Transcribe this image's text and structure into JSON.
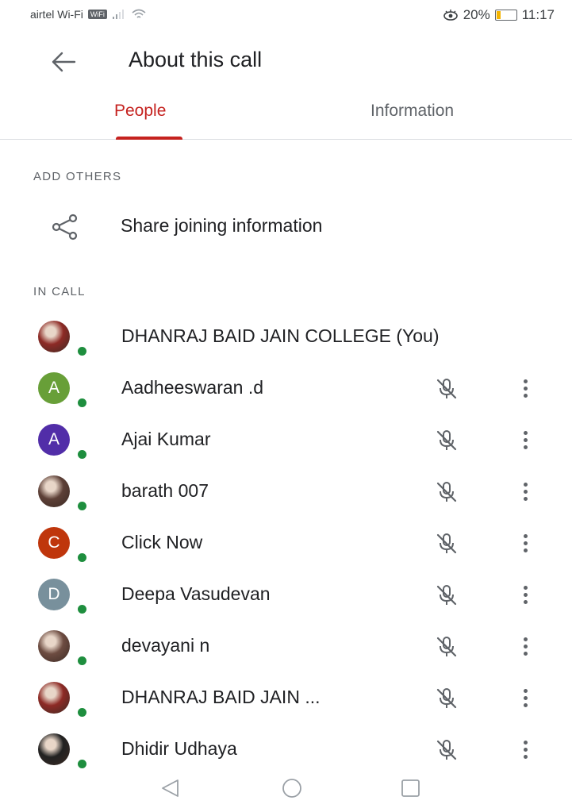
{
  "status_bar": {
    "carrier": "airtel Wi-Fi",
    "wifi_badge": "WiFi",
    "battery_percent": "20%",
    "time": "11:17",
    "battery_level": 0.2
  },
  "app_bar": {
    "title": "About this call"
  },
  "tabs": [
    {
      "label": "People",
      "active": true
    },
    {
      "label": "Information",
      "active": false
    }
  ],
  "add_others": {
    "header": "ADD OTHERS",
    "share_label": "Share joining information"
  },
  "in_call": {
    "header": "IN CALL",
    "participants": [
      {
        "name": "DHANRAJ BAID JAIN COLLEGE (You)",
        "avatar": "photo",
        "initial": "",
        "color": "#8d2a25",
        "is_self": true
      },
      {
        "name": "Aadheeswaran .d",
        "avatar": "letter",
        "initial": "A",
        "color": "#689f38",
        "is_self": false
      },
      {
        "name": "Ajai Kumar",
        "avatar": "letter",
        "initial": "A",
        "color": "#512da8",
        "is_self": false
      },
      {
        "name": "barath 007",
        "avatar": "photo",
        "initial": "",
        "color": "#5d4037",
        "is_self": false
      },
      {
        "name": "Click Now",
        "avatar": "letter",
        "initial": "C",
        "color": "#bf360c",
        "is_self": false
      },
      {
        "name": "Deepa Vasudevan",
        "avatar": "letter",
        "initial": "D",
        "color": "#78909c",
        "is_self": false
      },
      {
        "name": "devayani n",
        "avatar": "photo",
        "initial": "",
        "color": "#6d4c41",
        "is_self": false
      },
      {
        "name": "DHANRAJ BAID JAIN ...",
        "avatar": "photo",
        "initial": "",
        "color": "#8d2a25",
        "is_self": false
      },
      {
        "name": "Dhidir Udhaya",
        "avatar": "photo",
        "initial": "",
        "color": "#212121",
        "is_self": false
      }
    ]
  },
  "icons": {
    "back": "arrow-back-icon",
    "share": "share-icon",
    "mute": "mic-off-icon",
    "more": "more-vert-icon",
    "nav_back": "triangle-back-icon",
    "nav_home": "circle-home-icon",
    "nav_recents": "square-recents-icon"
  },
  "colors": {
    "accent": "#c5221f",
    "online": "#1e8e3e"
  }
}
